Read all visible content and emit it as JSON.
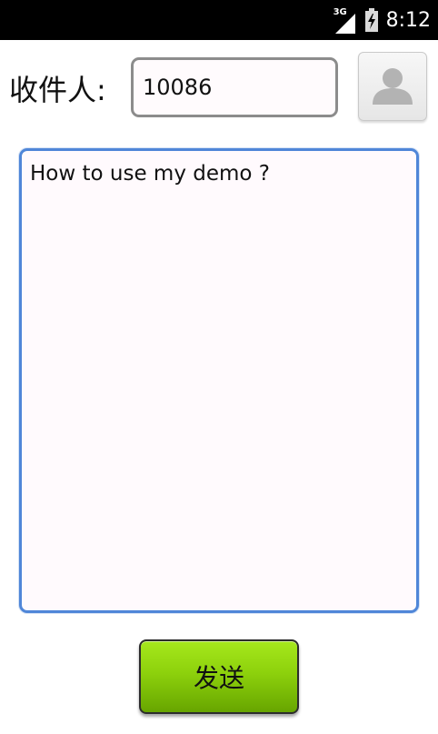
{
  "status_bar": {
    "network_type": "3G",
    "time": "8:12"
  },
  "recipient": {
    "label": "收件人:",
    "value": "10086"
  },
  "contact_button": {
    "icon": "person-icon"
  },
  "message": {
    "value": "How to use my demo ?"
  },
  "send_button": {
    "label": "发送"
  },
  "colors": {
    "status_bar_bg": "#000000",
    "message_border": "#4f86d8",
    "send_button_green": "#8dd10c"
  }
}
